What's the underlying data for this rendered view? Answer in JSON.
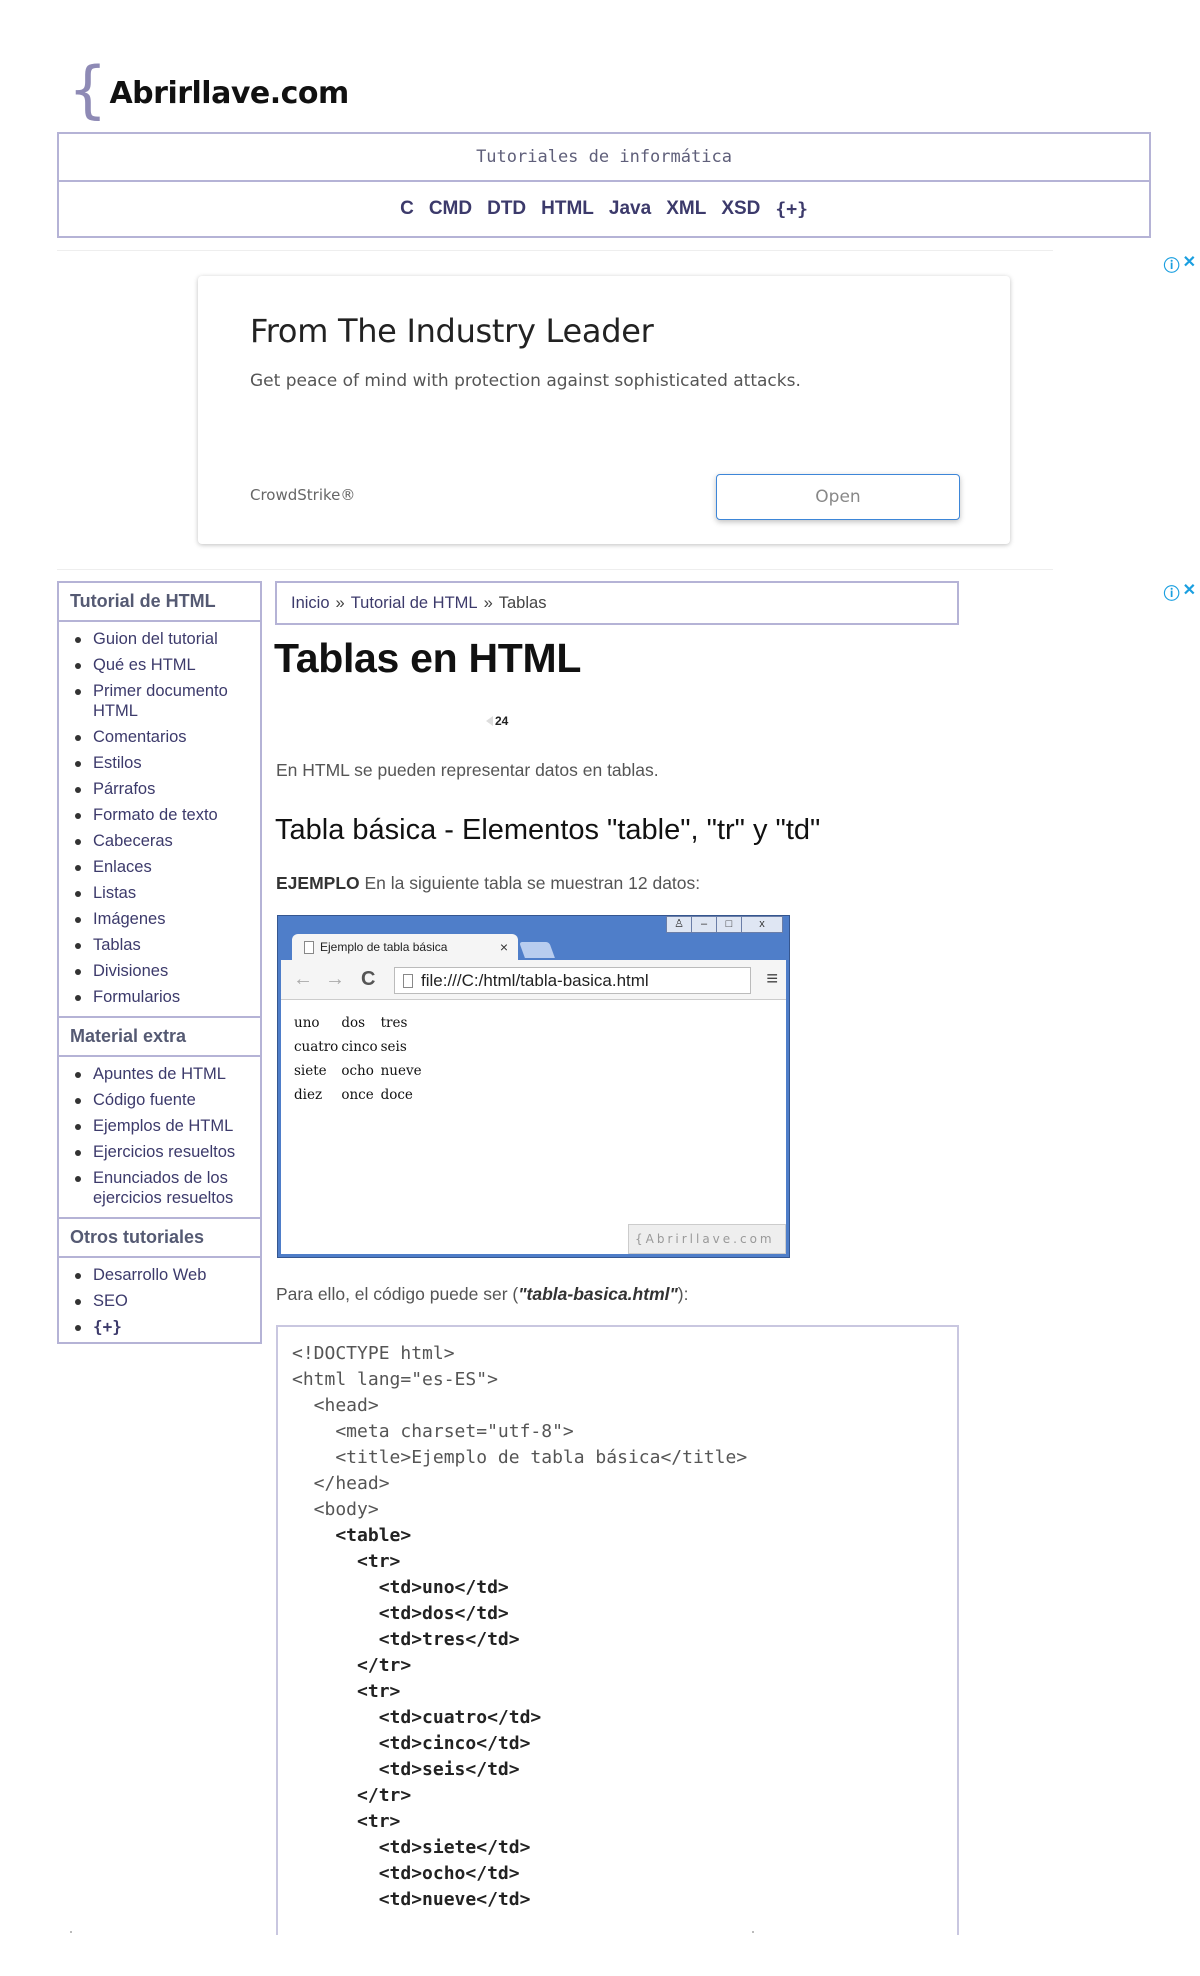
{
  "logo": {
    "brace": "{",
    "text": "Abrirllave.com"
  },
  "header": {
    "tagline": "Tutoriales de informática",
    "nav": [
      "C",
      "CMD",
      "DTD",
      "HTML",
      "Java",
      "XML",
      "XSD"
    ],
    "more": "{+}"
  },
  "ad": {
    "info_icon": "ⓘ",
    "close_icon": "✕",
    "title": "From The Industry Leader",
    "description": "Get peace of mind with protection against sophisticated attacks.",
    "brand": "CrowdStrike®",
    "button": "Open"
  },
  "sidebar": {
    "sections": [
      {
        "title": "Tutorial de HTML",
        "items": [
          "Guion del tutorial",
          "Qué es HTML",
          "Primer documento HTML",
          "Comentarios",
          "Estilos",
          "Párrafos",
          "Formato de texto",
          "Cabeceras",
          "Enlaces",
          "Listas",
          "Imágenes",
          "Tablas",
          "Divisiones",
          "Formularios"
        ]
      },
      {
        "title": "Material extra",
        "items": [
          "Apuntes de HTML",
          "Código fuente",
          "Ejemplos de HTML",
          "Ejercicios resueltos",
          "Enunciados de los ejercicios resueltos"
        ]
      },
      {
        "title": "Otros tutoriales",
        "items": [
          "Desarrollo Web",
          "SEO",
          "{+}"
        ]
      }
    ]
  },
  "breadcrumb": {
    "items": [
      "Inicio",
      "Tutorial de HTML",
      "Tablas"
    ],
    "separator": "»"
  },
  "main": {
    "title": "Tablas en HTML",
    "share_count": "24",
    "intro": "En HTML se pueden representar datos en tablas.",
    "subtitle": "Tabla básica - Elementos \"table\", \"tr\" y \"td\"",
    "example_label": "EJEMPLO",
    "example_text": " En la siguiente tabla se muestran 12 datos:",
    "code_intro_prefix": "Para ello, el código puede ser (",
    "code_filename": "\"tabla-basica.html\"",
    "code_intro_suffix": "):"
  },
  "browser": {
    "tab_title": "Ejemplo de tabla básica",
    "tab_close": "×",
    "url": "file:///C:/html/tabla-basica.html",
    "back_icon": "←",
    "forward_icon": "→",
    "reload_icon": "C",
    "menu_icon": "≡",
    "window_buttons": [
      "♙",
      "–",
      "□",
      "x"
    ],
    "table": [
      [
        "uno",
        "dos",
        "tres"
      ],
      [
        "cuatro",
        "cinco",
        "seis"
      ],
      [
        "siete",
        "ocho",
        "nueve"
      ],
      [
        "diez",
        "once",
        "doce"
      ]
    ],
    "watermark": "{Abrirllave.com"
  },
  "code_lines": [
    {
      "text": "<!DOCTYPE html>",
      "bold": false
    },
    {
      "text": "<html lang=\"es-ES\">",
      "bold": false
    },
    {
      "text": "  <head>",
      "bold": false
    },
    {
      "text": "    <meta charset=\"utf-8\">",
      "bold": false
    },
    {
      "text": "    <title>Ejemplo de tabla básica</title>",
      "bold": false
    },
    {
      "text": "  </head>",
      "bold": false
    },
    {
      "text": "  <body>",
      "bold": false
    },
    {
      "text": "    <table>",
      "bold": true
    },
    {
      "text": "      <tr>",
      "bold": true
    },
    {
      "text": "        <td>uno</td>",
      "bold": true
    },
    {
      "text": "        <td>dos</td>",
      "bold": true
    },
    {
      "text": "        <td>tres</td>",
      "bold": true
    },
    {
      "text": "      </tr>",
      "bold": true
    },
    {
      "text": "      <tr>",
      "bold": true
    },
    {
      "text": "        <td>cuatro</td>",
      "bold": true
    },
    {
      "text": "        <td>cinco</td>",
      "bold": true
    },
    {
      "text": "        <td>seis</td>",
      "bold": true
    },
    {
      "text": "      </tr>",
      "bold": true
    },
    {
      "text": "      <tr>",
      "bold": true
    },
    {
      "text": "        <td>siete</td>",
      "bold": true
    },
    {
      "text": "        <td>ocho</td>",
      "bold": true
    },
    {
      "text": "        <td>nueve</td>",
      "bold": true
    }
  ]
}
